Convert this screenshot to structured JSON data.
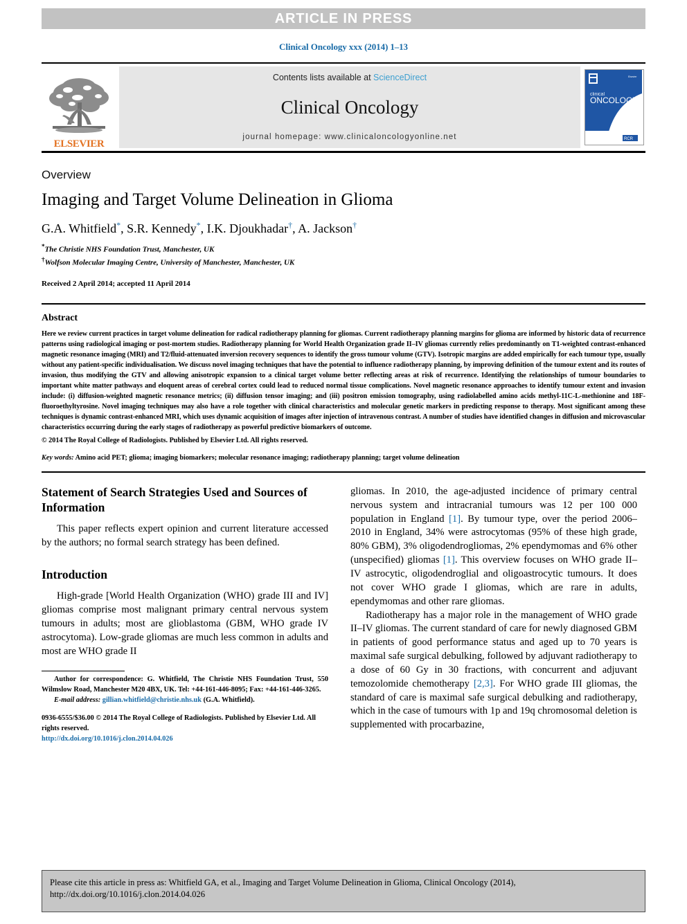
{
  "banner": {
    "text": "ARTICLE IN PRESS"
  },
  "journal_ref": "Clinical Oncology xxx (2014) 1–13",
  "masthead": {
    "publisher_name": "ELSEVIER",
    "publisher_logo_icon": "elsevier-tree-icon",
    "contents_prefix": "Contents lists available at ",
    "contents_link": "ScienceDirect",
    "journal_title": "Clinical Oncology",
    "homepage": "journal homepage: www.clinicaloncologyonline.net",
    "cover": {
      "line1": "clinical",
      "line2": "ONCOLOGY",
      "corner_label": "Elsevier",
      "badge": "RCR"
    }
  },
  "article": {
    "type_label": "Overview",
    "title": "Imaging and Target Volume Delineation in Glioma",
    "authors": [
      {
        "name": "G.A. Whitfield",
        "mark": "*",
        "sep": ", "
      },
      {
        "name": "S.R. Kennedy",
        "mark": "*",
        "sep": ", "
      },
      {
        "name": "I.K. Djoukhadar",
        "mark": "†",
        "sep": ", "
      },
      {
        "name": "A. Jackson",
        "mark": "†",
        "sep": ""
      }
    ],
    "affiliations": [
      {
        "mark": "*",
        "text": "The Christie NHS Foundation Trust, Manchester, UK"
      },
      {
        "mark": "†",
        "text": "Wolfson Molecular Imaging Centre, University of Manchester, Manchester, UK"
      }
    ],
    "received": "Received 2 April 2014; accepted 11 April 2014"
  },
  "abstract": {
    "heading": "Abstract",
    "text": "Here we review current practices in target volume delineation for radical radiotherapy planning for gliomas. Current radiotherapy planning margins for glioma are informed by historic data of recurrence patterns using radiological imaging or post-mortem studies. Radiotherapy planning for World Health Organization grade II–IV gliomas currently relies predominantly on T1-weighted contrast-enhanced magnetic resonance imaging (MRI) and T2/fluid-attenuated inversion recovery sequences to identify the gross tumour volume (GTV). Isotropic margins are added empirically for each tumour type, usually without any patient-specific individualisation. We discuss novel imaging techniques that have the potential to influence radiotherapy planning, by improving definition of the tumour extent and its routes of invasion, thus modifying the GTV and allowing anisotropic expansion to a clinical target volume better reflecting areas at risk of recurrence. Identifying the relationships of tumour boundaries to important white matter pathways and eloquent areas of cerebral cortex could lead to reduced normal tissue complications. Novel magnetic resonance approaches to identify tumour extent and invasion include: (i) diffusion-weighted magnetic resonance metrics; (ii) diffusion tensor imaging; and (iii) positron emission tomography, using radiolabelled amino acids methyl-11C-L-methionine and 18F-fluoroethyltyrosine. Novel imaging techniques may also have a role together with clinical characteristics and molecular genetic markers in predicting response to therapy. Most significant among these techniques is dynamic contrast-enhanced MRI, which uses dynamic acquisition of images after injection of intravenous contrast. A number of studies have identified changes in diffusion and microvascular characteristics occurring during the early stages of radiotherapy as powerful predictive biomarkers of outcome.",
    "copyright": "© 2014 The Royal College of Radiologists. Published by Elsevier Ltd. All rights reserved.",
    "keywords_label": "Key words:",
    "keywords": " Amino acid PET; glioma; imaging biomarkers; molecular resonance imaging; radiotherapy planning; target volume delineation"
  },
  "body": {
    "left": {
      "search_heading": "Statement of Search Strategies Used and Sources of Information",
      "search_paragraph": "This paper reflects expert opinion and current literature accessed by the authors; no formal search strategy has been defined.",
      "intro_heading": "Introduction",
      "intro_paragraph": "High-grade [World Health Organization (WHO) grade III and IV] gliomas comprise most malignant primary central nervous system tumours in adults; most are glioblastoma (GBM, WHO grade IV astrocytoma). Low-grade gliomas are much less common in adults and most are WHO grade II"
    },
    "right": {
      "p1_a": "gliomas. In 2010, the age-adjusted incidence of primary central nervous system and intracranial tumours was 12 per 100 000 population in England ",
      "p1_ref1": "[1]",
      "p1_b": ". By tumour type, over the period 2006–2010 in England, 34% were astrocytomas (95% of these high grade, 80% GBM), 3% oligodendrogliomas, 2% ependymomas and 6% other (unspecified) gliomas ",
      "p1_ref2": "[1]",
      "p1_c": ". This overview focuses on WHO grade II–IV astrocytic, oligodendroglial and oligoastrocytic tumours. It does not cover WHO grade I gliomas, which are rare in adults, ependymomas and other rare gliomas.",
      "p2_a": "Radiotherapy has a major role in the management of WHO grade II–IV gliomas. The current standard of care for newly diagnosed GBM in patients of good performance status and aged up to 70 years is maximal safe surgical debulking, followed by adjuvant radiotherapy to a dose of 60 Gy in 30 fractions, with concurrent and adjuvant temozolomide chemotherapy ",
      "p2_ref": "[2,3]",
      "p2_b": ". For WHO grade III gliomas, the standard of care is maximal safe surgical debulking and radiotherapy, which in the case of tumours with 1p and 19q chromosomal deletion is supplemented with procarbazine,"
    }
  },
  "footnote": {
    "correspondence": "Author for correspondence: G. Whitfield, The Christie NHS Foundation Trust, 550 Wilmslow Road, Manchester M20 4BX, UK. Tel: +44-161-446-8095; Fax: +44-161-446-3265.",
    "email_label": "E-mail address:",
    "email": "gillian.whitfield@christie.nhs.uk",
    "email_owner": "(G.A. Whitfield).",
    "issn_line": "0936-6555/$36.00 © 2014 The Royal College of Radiologists. Published by Elsevier Ltd. All rights reserved.",
    "doi_line": "http://dx.doi.org/10.1016/j.clon.2014.04.026"
  },
  "citation_box": {
    "text": "Please cite this article in press as: Whitfield GA, et al., Imaging and Target Volume Delineation in Glioma, Clinical Oncology (2014), http://dx.doi.org/10.1016/j.clon.2014.04.026"
  },
  "colors": {
    "link_blue": "#1a6ca8",
    "sciencedirect_blue": "#3d9fd0",
    "elsevier_orange": "#e37222",
    "banner_grey": "#c2c2c2",
    "masthead_grey": "#e6e6e6",
    "citebox_grey": "#c6c6c6",
    "cover_blue": "#1f56a5"
  }
}
